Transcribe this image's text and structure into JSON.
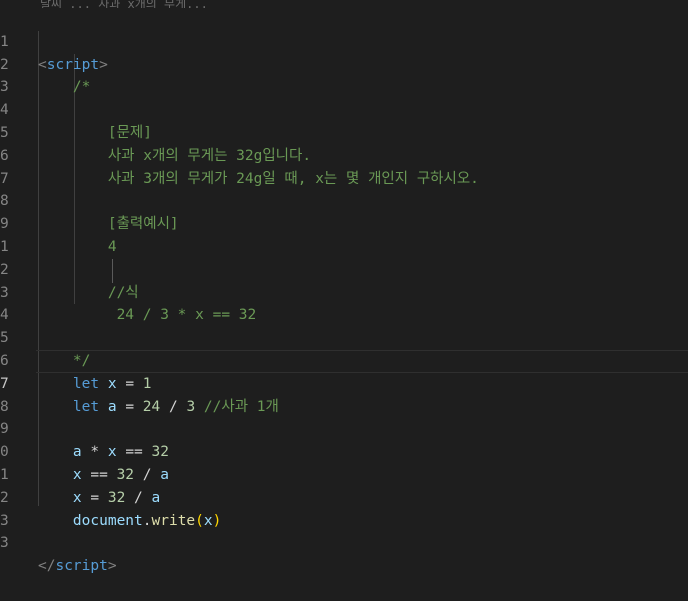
{
  "top_fragment": "날씨 ... 사과 x개의 무게... ",
  "line_numbers": [
    "1",
    "2",
    "3",
    "4",
    "5",
    "6",
    "7",
    "8",
    "9",
    "1",
    "2",
    "3",
    "4",
    "5",
    "6",
    "7",
    "8",
    "9",
    "0",
    "1",
    "2",
    "3"
  ],
  "code": {
    "open_tag_lt": "<",
    "open_tag_name": "script",
    "open_tag_gt": ">",
    "comment_open": "/*",
    "problem_title": "[문제]",
    "problem_line1": "사과 x개의 무게는 32g입니다.",
    "problem_line2": "사과 3개의 무게가 24g일 때, x는 몇 개인지 구하시오.",
    "output_title": "[출력예시]",
    "output_value": "4",
    "formula_title": "//식",
    "formula": "24 / 3 * x == 32",
    "comment_close": "*/",
    "let1_kw": "let",
    "let1_var": "x",
    "let1_eq": " = ",
    "let1_val": "1",
    "let2_kw": "let",
    "let2_var": "a",
    "let2_eq": " = ",
    "let2_num1": "24",
    "let2_div": " / ",
    "let2_num2": "3",
    "let2_comment": " //사과 1개",
    "expr1_a": "a",
    "expr1_op": " * ",
    "expr1_x": "x",
    "expr1_eq": " == ",
    "expr1_num": "32",
    "expr2_x": "x",
    "expr2_eq": " == ",
    "expr2_num": "32",
    "expr2_div": " / ",
    "expr2_a": "a",
    "expr3_x": "x",
    "expr3_eq": " = ",
    "expr3_num": "32",
    "expr3_div": " / ",
    "expr3_a": "a",
    "doc_obj": "document",
    "doc_dot": ".",
    "doc_fn": "write",
    "doc_lp": "(",
    "doc_arg": "x",
    "doc_rp": ")",
    "close_tag_lt": "</",
    "close_tag_name": "script",
    "close_tag_gt": ">"
  },
  "colors": {
    "background": "#1e1e1e",
    "tag": "#569cd6",
    "comment": "#6a9955",
    "variable": "#9cdcfe",
    "number": "#b5cea8",
    "function": "#dcdcaa"
  }
}
